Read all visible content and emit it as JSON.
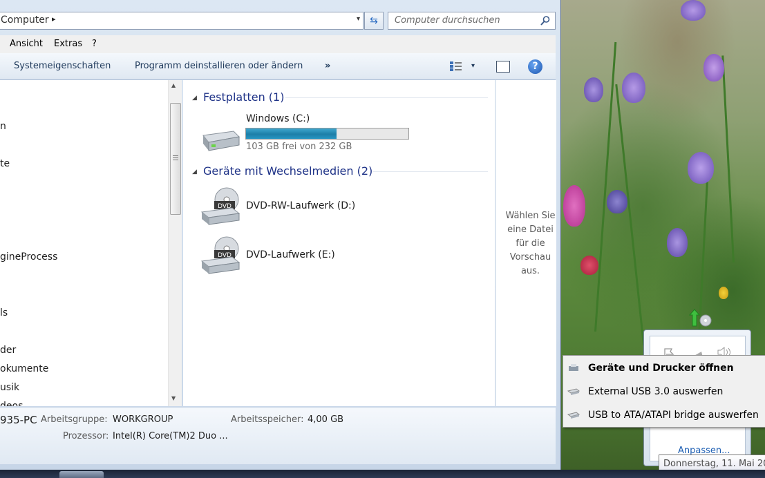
{
  "address": {
    "path_label": "Computer",
    "path_separator": "▸",
    "dropdown": "▾",
    "refresh": "⇆"
  },
  "search": {
    "placeholder": "Computer durchsuchen",
    "icon": "search-icon"
  },
  "menu": {
    "items": [
      "Ansicht",
      "Extras",
      "?"
    ]
  },
  "toolbar": {
    "system_properties": "Systemeigenschaften",
    "uninstall": "Programm deinstallieren oder ändern",
    "more": "»",
    "view_dropdown": "▾",
    "help": "?"
  },
  "nav": {
    "items": [
      "n",
      "te",
      "gineProcess",
      "ls",
      "der",
      "okumente",
      "usik",
      "deos"
    ]
  },
  "content": {
    "groups": [
      {
        "title": "Festplatten (1)"
      },
      {
        "title": "Geräte mit Wechselmedien (2)"
      }
    ],
    "drives": [
      {
        "name": "Windows (C:)",
        "free_text": "103 GB frei von 232 GB",
        "used_fraction": 0.556
      },
      {
        "name": "DVD-RW-Laufwerk (D:)",
        "icon_text": "DVD"
      },
      {
        "name": "DVD-Laufwerk (E:)",
        "icon_text": "DVD"
      }
    ]
  },
  "preview": {
    "text": "Wählen Sie eine Datei für die Vorschau aus."
  },
  "status": {
    "pc_name": "935-PC",
    "workgroup_label": "Arbeitsgruppe:",
    "workgroup_value": "WORKGROUP",
    "memory_label": "Arbeitsspeicher:",
    "memory_value": "4,00 GB",
    "cpu_label": "Prozessor:",
    "cpu_value": "Intel(R) Core(TM)2 Duo ..."
  },
  "tray": {
    "customize": "Anpassen..."
  },
  "context_menu": {
    "items": [
      {
        "label": "Geräte und Drucker öffnen",
        "bold": true
      },
      {
        "label": "External USB 3.0 auswerfen",
        "bold": false
      },
      {
        "label": "USB to ATA/ATAPI bridge auswerfen",
        "bold": false
      }
    ]
  },
  "clock": {
    "tooltip": "Donnerstag, 11. Mai 20"
  },
  "colors": {
    "accent": "#1e3287",
    "progress": "#1d7fa8",
    "link": "#1e5fb3"
  }
}
